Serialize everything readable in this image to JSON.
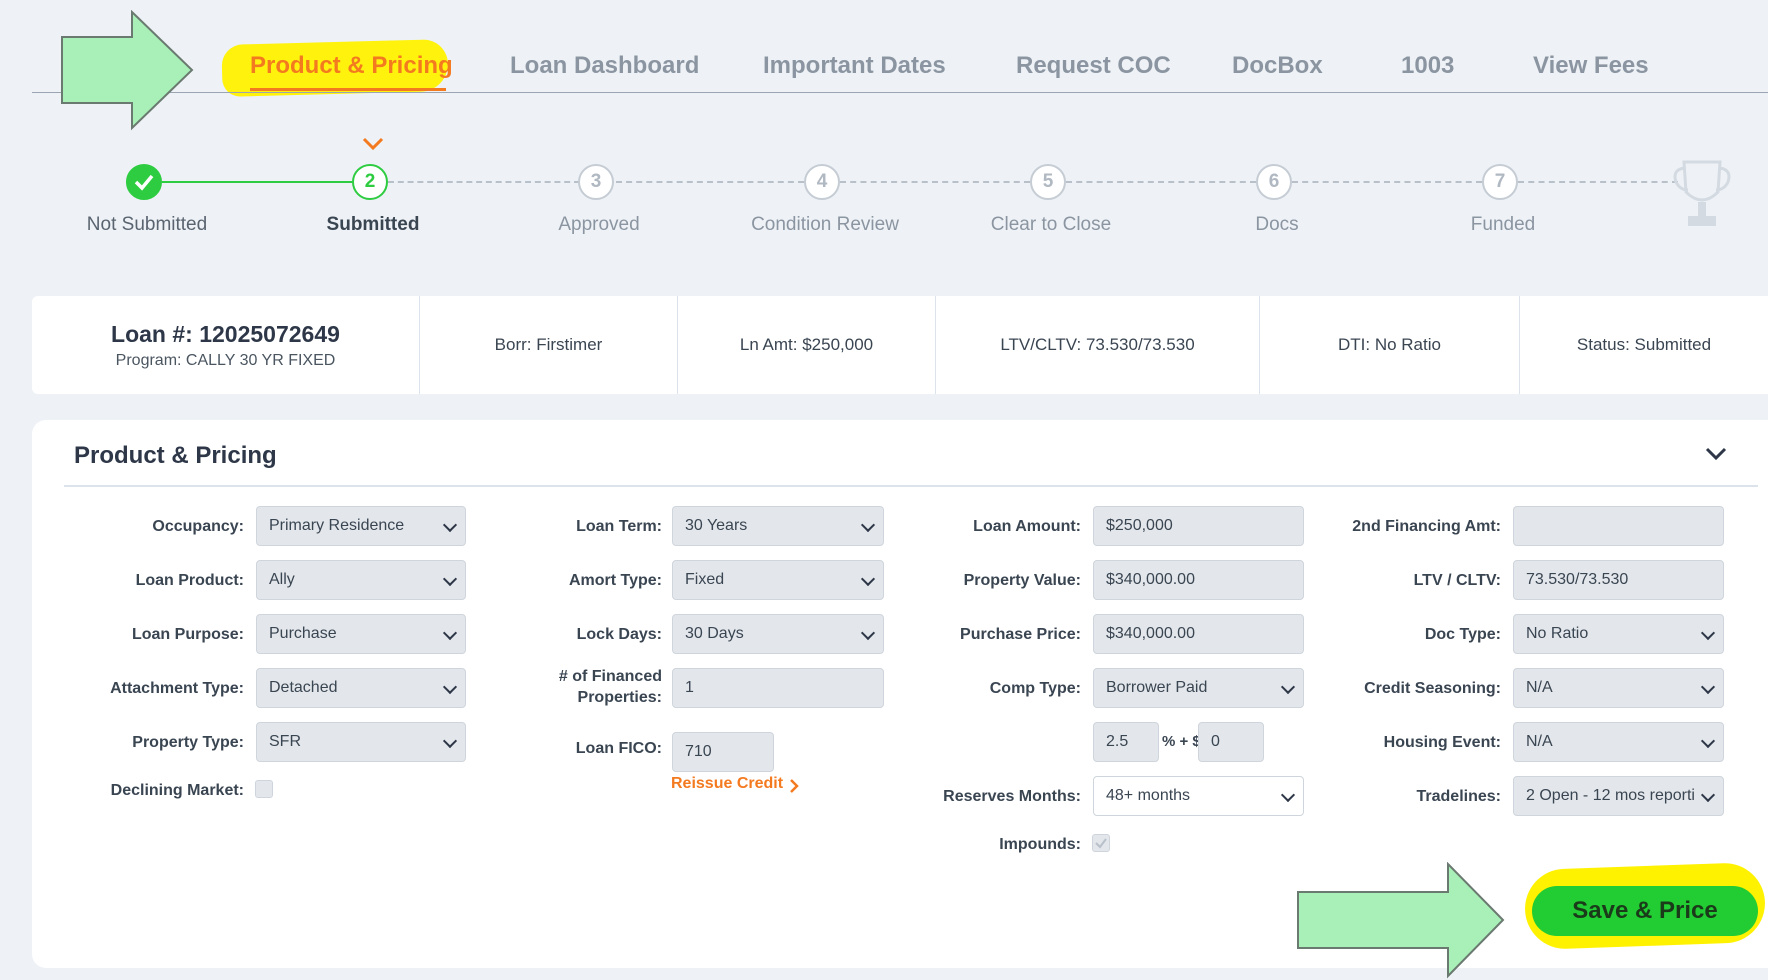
{
  "nav": {
    "tabs": [
      {
        "label": "Product & Pricing"
      },
      {
        "label": "Loan Dashboard"
      },
      {
        "label": "Important Dates"
      },
      {
        "label": "Request COC"
      },
      {
        "label": "DocBox"
      },
      {
        "label": "1003"
      },
      {
        "label": "View Fees"
      }
    ]
  },
  "stepper": {
    "current_step": 2,
    "steps": [
      {
        "number": "",
        "label": "Not Submitted"
      },
      {
        "number": "2",
        "label": "Submitted"
      },
      {
        "number": "3",
        "label": "Approved"
      },
      {
        "number": "4",
        "label": "Condition Review"
      },
      {
        "number": "5",
        "label": "Clear to Close"
      },
      {
        "number": "6",
        "label": "Docs"
      },
      {
        "number": "7",
        "label": "Funded"
      }
    ]
  },
  "summary": {
    "loan_number": "Loan #: 12025072649",
    "program": "Program: CALLY 30 YR FIXED",
    "borrower": "Borr: Firstimer",
    "loan_amount": "Ln Amt: $250,000",
    "ltv": "LTV/CLTV: 73.530/73.530",
    "dti": "DTI: No Ratio",
    "status": "Status: Submitted"
  },
  "panel": {
    "title": "Product & Pricing",
    "col1": {
      "occupancy": {
        "label": "Occupancy:",
        "value": "Primary Residence"
      },
      "loan_product": {
        "label": "Loan Product:",
        "value": "Ally"
      },
      "loan_purpose": {
        "label": "Loan Purpose:",
        "value": "Purchase"
      },
      "attachment_type": {
        "label": "Attachment Type:",
        "value": "Detached"
      },
      "property_type": {
        "label": "Property Type:",
        "value": "SFR"
      },
      "declining_market": {
        "label": "Declining Market:"
      }
    },
    "col2": {
      "loan_term": {
        "label": "Loan Term:",
        "value": "30 Years"
      },
      "amort_type": {
        "label": "Amort Type:",
        "value": "Fixed"
      },
      "lock_days": {
        "label": "Lock Days:",
        "value": "30 Days"
      },
      "financed_props": {
        "label1": "# of Financed",
        "label2": "Properties:",
        "value": "1"
      },
      "loan_fico": {
        "label": "Loan FICO:",
        "value": "710"
      },
      "reissue_credit": "Reissue Credit"
    },
    "col3": {
      "loan_amount": {
        "label": "Loan Amount:",
        "value": "$250,000"
      },
      "property_value": {
        "label": "Property Value:",
        "value": "$340,000.00"
      },
      "purchase_price": {
        "label": "Purchase Price:",
        "value": "$340,000.00"
      },
      "comp_type": {
        "label": "Comp Type:",
        "value": "Borrower Paid"
      },
      "comp_pct": "2.5",
      "comp_sep": "% + $",
      "comp_flat": "0",
      "reserves_months": {
        "label": "Reserves Months:",
        "value": "48+ months"
      },
      "impounds": {
        "label": "Impounds:"
      }
    },
    "col4": {
      "second_financing": {
        "label": "2nd Financing Amt:",
        "value": ""
      },
      "ltv_cltv": {
        "label": "LTV / CLTV:",
        "value": "73.530/73.530"
      },
      "doc_type": {
        "label": "Doc Type:",
        "value": "No Ratio"
      },
      "credit_seasoning": {
        "label": "Credit Seasoning:",
        "value": "N/A"
      },
      "housing_event": {
        "label": "Housing Event:",
        "value": "N/A"
      },
      "tradelines": {
        "label": "Tradelines:",
        "value": "2 Open - 12 mos reporti"
      }
    },
    "save_label": "Save & Price"
  },
  "colors": {
    "accent": "#f47a20",
    "success": "#2ecc40",
    "highlight": "#fff200",
    "annotation_arrow": "#a8f0b8"
  }
}
